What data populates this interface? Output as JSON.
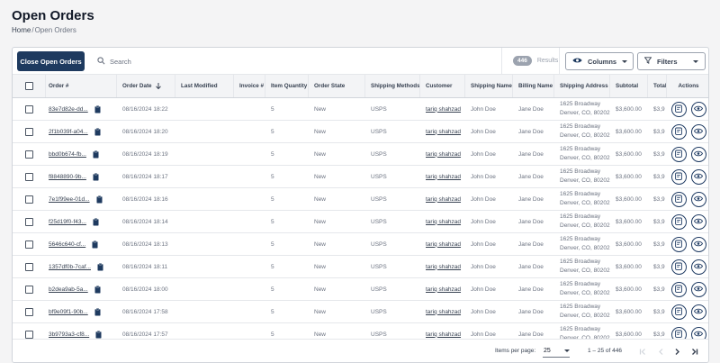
{
  "page": {
    "title": "Open Orders",
    "breadcrumb": {
      "home": "Home",
      "separator": "/",
      "current": "Open Orders"
    }
  },
  "toolbar": {
    "close_orders_label": "Close Open Orders",
    "search_placeholder": "Search",
    "results_count": "446",
    "results_label": "Results",
    "columns_label": "Columns",
    "filters_label": "Filters"
  },
  "table": {
    "headers": {
      "order": "Order #",
      "date": "Order Date",
      "modified": "Last Modified",
      "invoice": "Invoice #",
      "qty": "Item Quantity",
      "state": "Order State",
      "shipping_methods": "Shipping Methods",
      "customer": "Customer",
      "shipping_name": "Shipping Name",
      "billing_name": "Billing Name",
      "shipping_address": "Shipping Address",
      "subtotal": "Subtotal",
      "total": "Total",
      "actions": "Actions"
    },
    "rows": [
      {
        "order": "83e7d82e-dd...",
        "date": "08/16/2024 18:22",
        "qty": "5",
        "state": "New",
        "ship": "USPS",
        "customer": "tariq shahzad",
        "sname": "John Doe",
        "bname": "Jane Doe",
        "addr1": "1625 Broadway",
        "addr2": "Denver, CO, 80202",
        "subtotal": "$3,600.00",
        "total": "$3,9"
      },
      {
        "order": "2f1b039f-a04...",
        "date": "08/16/2024 18:20",
        "qty": "5",
        "state": "New",
        "ship": "USPS",
        "customer": "tariq shahzad",
        "sname": "John Doe",
        "bname": "Jane Doe",
        "addr1": "1625 Broadway",
        "addr2": "Denver, CO, 80202",
        "subtotal": "$3,600.00",
        "total": "$3,9"
      },
      {
        "order": "bbd0b674-fb...",
        "date": "08/16/2024 18:19",
        "qty": "5",
        "state": "New",
        "ship": "USPS",
        "customer": "tariq shahzad",
        "sname": "John Doe",
        "bname": "Jane Doe",
        "addr1": "1625 Broadway",
        "addr2": "Denver, CO, 80202",
        "subtotal": "$3,600.00",
        "total": "$3,9"
      },
      {
        "order": "f8848890-9b...",
        "date": "08/16/2024 18:17",
        "qty": "5",
        "state": "New",
        "ship": "USPS",
        "customer": "tariq shahzad",
        "sname": "John Doe",
        "bname": "Jane Doe",
        "addr1": "1625 Broadway",
        "addr2": "Denver, CO, 80202",
        "subtotal": "$3,600.00",
        "total": "$3,9"
      },
      {
        "order": "7e1f99ee-01d...",
        "date": "08/16/2024 18:16",
        "qty": "5",
        "state": "New",
        "ship": "USPS",
        "customer": "tariq shahzad",
        "sname": "John Doe",
        "bname": "Jane Doe",
        "addr1": "1625 Broadway",
        "addr2": "Denver, CO, 80202",
        "subtotal": "$3,600.00",
        "total": "$3,9"
      },
      {
        "order": "f25d19f0-f43...",
        "date": "08/16/2024 18:14",
        "qty": "5",
        "state": "New",
        "ship": "USPS",
        "customer": "tariq shahzad",
        "sname": "John Doe",
        "bname": "Jane Doe",
        "addr1": "1625 Broadway",
        "addr2": "Denver, CO, 80202",
        "subtotal": "$3,600.00",
        "total": "$3,9"
      },
      {
        "order": "5646c640-cf...",
        "date": "08/16/2024 18:13",
        "qty": "5",
        "state": "New",
        "ship": "USPS",
        "customer": "tariq shahzad",
        "sname": "John Doe",
        "bname": "Jane Doe",
        "addr1": "1625 Broadway",
        "addr2": "Denver, CO, 80202",
        "subtotal": "$3,600.00",
        "total": "$3,9"
      },
      {
        "order": "1357df0b-7caf...",
        "date": "08/16/2024 18:11",
        "qty": "5",
        "state": "New",
        "ship": "USPS",
        "customer": "tariq shahzad",
        "sname": "John Doe",
        "bname": "Jane Doe",
        "addr1": "1625 Broadway",
        "addr2": "Denver, CO, 80202",
        "subtotal": "$3,600.00",
        "total": "$3,9"
      },
      {
        "order": "b2dea9ab-5a...",
        "date": "08/16/2024 18:00",
        "qty": "5",
        "state": "New",
        "ship": "USPS",
        "customer": "tariq shahzad",
        "sname": "John Doe",
        "bname": "Jane Doe",
        "addr1": "1625 Broadway",
        "addr2": "Denver, CO, 80202",
        "subtotal": "$3,600.00",
        "total": "$3,9"
      },
      {
        "order": "bf9e09f1-90b...",
        "date": "08/16/2024 17:58",
        "qty": "5",
        "state": "New",
        "ship": "USPS",
        "customer": "tariq shahzad",
        "sname": "John Doe",
        "bname": "Jane Doe",
        "addr1": "1625 Broadway",
        "addr2": "Denver, CO, 80202",
        "subtotal": "$3,600.00",
        "total": "$3,9"
      },
      {
        "order": "3b9793a3-cf8...",
        "date": "08/16/2024 17:57",
        "qty": "5",
        "state": "New",
        "ship": "USPS",
        "customer": "tariq shahzad",
        "sname": "John Doe",
        "bname": "Jane Doe",
        "addr1": "1625 Broadway",
        "addr2": "Denver, CO, 80202",
        "subtotal": "$3,600.00",
        "total": "$3,9"
      }
    ]
  },
  "footer": {
    "items_per_page_label": "Items per page:",
    "items_per_page_value": "25",
    "range_label": "1 – 25 of 446"
  },
  "colors": {
    "primary": "#1e3a5f",
    "muted_text": "#6b7280",
    "header_bg": "#f3f4f6"
  },
  "icons": [
    "search-icon",
    "eye-icon",
    "filter-icon",
    "clipboard-icon",
    "sort-down-icon",
    "notes-icon",
    "view-icon",
    "first-page-icon",
    "prev-page-icon",
    "next-page-icon",
    "last-page-icon"
  ]
}
